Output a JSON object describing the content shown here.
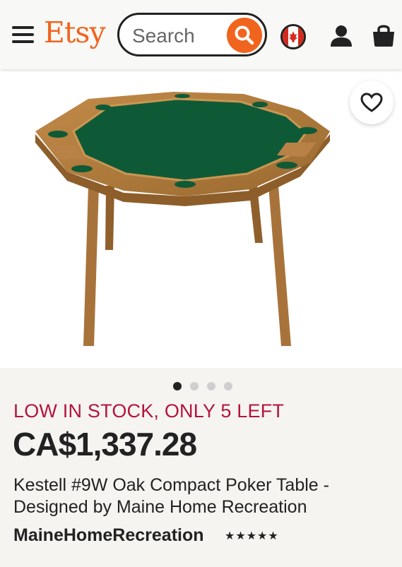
{
  "header": {
    "logo": "Etsy",
    "search_placeholder": "Search",
    "menu_icon": "hamburger-menu-icon",
    "region_icon": "canada-flag-icon",
    "user_icon": "user-icon",
    "cart_icon": "shopping-bag-icon"
  },
  "gallery": {
    "image_description_icon": "product-image",
    "favorite_icon": "heart-outline-icon",
    "image_count": 4,
    "active_index": 0
  },
  "listing": {
    "stock_notice": "LOW IN STOCK, ONLY 5 LEFT",
    "price": "CA$1,337.28",
    "title": "Kestell #9W Oak Compact Poker Table - Designed by Maine Home Recreation",
    "shop_name": "MaineHomeRecreation",
    "rating_stars": "★★★★★"
  },
  "colors": {
    "brand": "#F1641E",
    "stock_alert": "#b4143c",
    "text": "#222222",
    "felt": "#0f5a36",
    "wood": "#b07a3a"
  }
}
